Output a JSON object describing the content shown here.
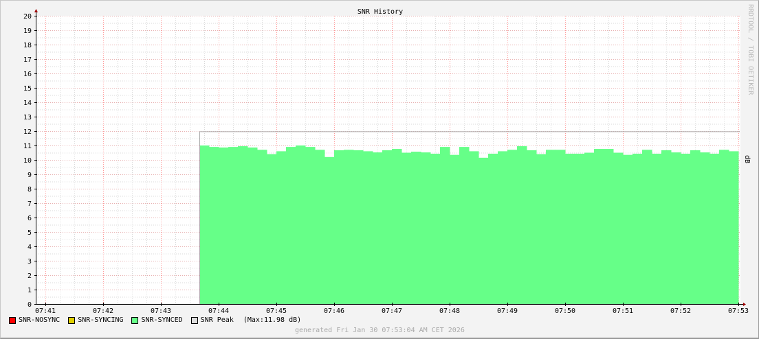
{
  "chart_data": {
    "type": "area",
    "title": "SNR History",
    "ylabel": "dB",
    "ylim": [
      0,
      20
    ],
    "yticks": [
      0,
      1,
      2,
      3,
      4,
      5,
      6,
      7,
      8,
      9,
      10,
      11,
      12,
      13,
      14,
      15,
      16,
      17,
      18,
      19,
      20
    ],
    "xticks": [
      "07:41",
      "07:42",
      "07:43",
      "07:44",
      "07:45",
      "07:46",
      "07:47",
      "07:48",
      "07:49",
      "07:50",
      "07:51",
      "07:52",
      "07:53"
    ],
    "xrange": [
      "07:40:50",
      "07:53:00"
    ],
    "grid": true,
    "start_time": "07:43:40",
    "step_seconds": 10,
    "series": [
      {
        "name": "SNR-NOSYNC",
        "color": "#ff0000",
        "values": []
      },
      {
        "name": "SNR-SYNCING",
        "color": "#e0d000",
        "values": []
      },
      {
        "name": "SNR-SYNCED",
        "color": "#66ff88",
        "values": [
          11.0,
          10.9,
          10.86,
          10.9,
          10.95,
          10.86,
          10.7,
          10.4,
          10.6,
          10.9,
          11.0,
          10.9,
          10.7,
          10.2,
          10.67,
          10.7,
          10.67,
          10.6,
          10.52,
          10.67,
          10.76,
          10.5,
          10.57,
          10.52,
          10.43,
          10.9,
          10.35,
          10.9,
          10.6,
          10.15,
          10.43,
          10.6,
          10.7,
          10.95,
          10.67,
          10.4,
          10.7,
          10.7,
          10.43,
          10.43,
          10.5,
          10.76,
          10.76,
          10.5,
          10.35,
          10.43,
          10.7,
          10.43,
          10.67,
          10.52,
          10.43,
          10.67,
          10.52,
          10.43,
          10.7,
          10.6
        ]
      },
      {
        "name": "SNR Peak",
        "color": "#dddddd",
        "value": 11.98
      }
    ],
    "legend_placement": "bottom-left",
    "peak_label": "(Max:11.98 dB)"
  },
  "watermark": "RRDTOOL / TOBI OETIKER",
  "generated": "generated Fri Jan 30 07:53:04 AM CET 2026"
}
